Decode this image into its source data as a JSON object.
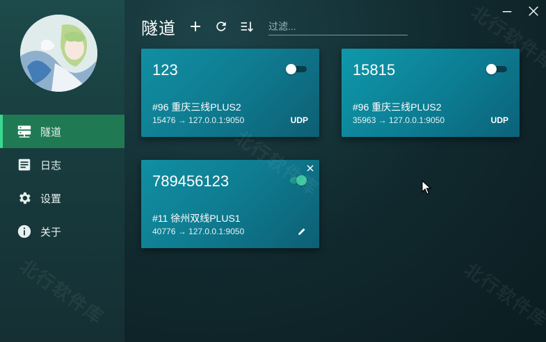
{
  "window": {
    "minimize_icon": "minimize-icon",
    "close_icon": "close-icon"
  },
  "sidebar": {
    "items": [
      {
        "label": "隧道",
        "icon": "server-icon",
        "active": true
      },
      {
        "label": "日志",
        "icon": "document-icon",
        "active": false
      },
      {
        "label": "设置",
        "icon": "gear-icon",
        "active": false
      },
      {
        "label": "关于",
        "icon": "info-icon",
        "active": false
      }
    ]
  },
  "toolbar": {
    "title": "隧道",
    "filter_placeholder": "过滤..."
  },
  "tunnels": [
    {
      "name": "123",
      "server": "#96 重庆三线PLUS2",
      "route": "15476 → 127.0.0.1:9050",
      "protocol": "UDP",
      "enabled": false
    },
    {
      "name": "15815",
      "server": "#96 重庆三线PLUS2",
      "route": "35963 → 127.0.0.1:9050",
      "protocol": "UDP",
      "enabled": false
    },
    {
      "name": "789456123",
      "server": "#11 徐州双线PLUS1",
      "route": "40776 → 127.0.0.1:9050",
      "protocol": "",
      "enabled": true
    }
  ],
  "watermark": "北行软件库",
  "colors": {
    "accent": "#1f7a53",
    "accent_bar": "#38d98f",
    "card": "#0f7d92",
    "toggle_on": "#3fc4a2"
  }
}
